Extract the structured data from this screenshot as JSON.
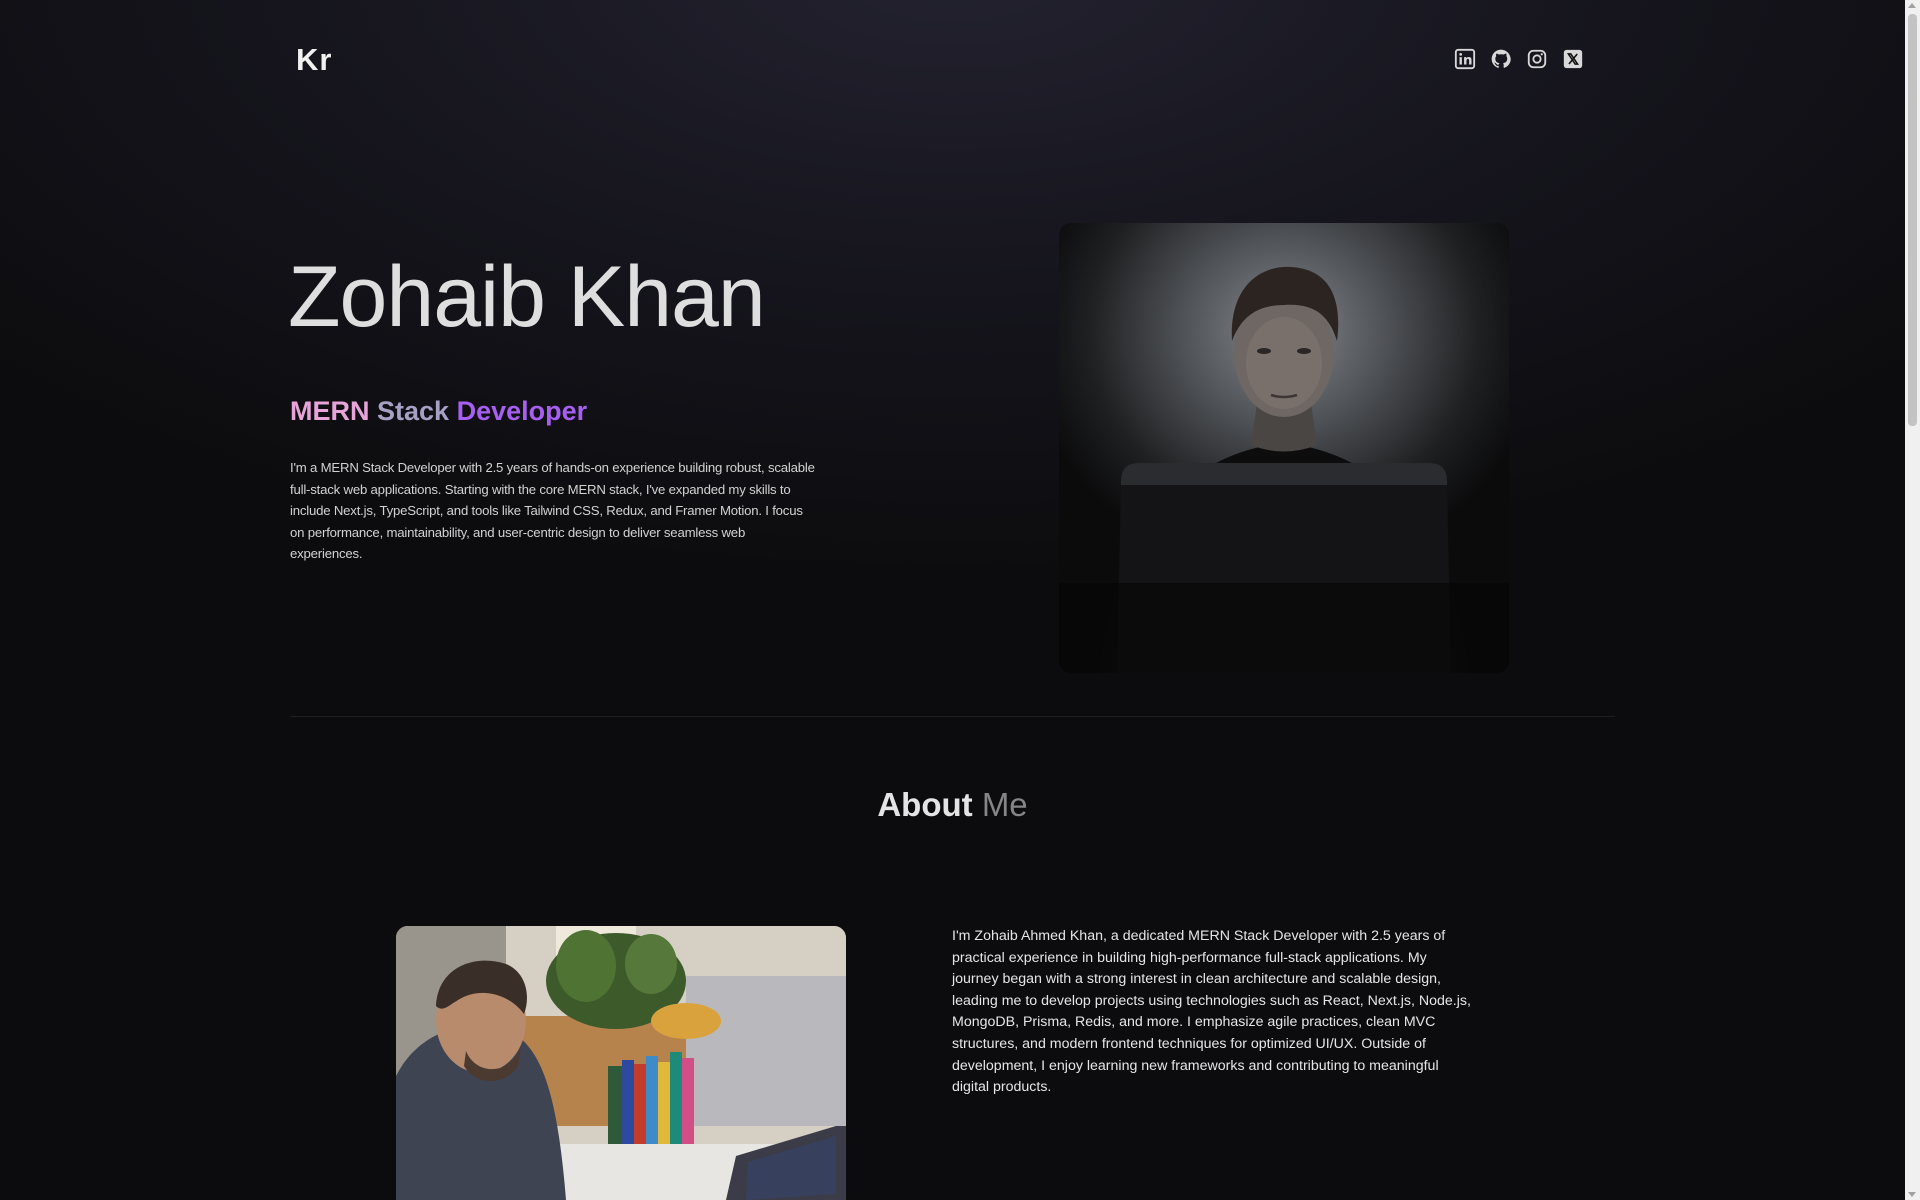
{
  "header": {
    "logo": "Kr",
    "socials": [
      {
        "icon": "linkedin-icon"
      },
      {
        "icon": "github-icon"
      },
      {
        "icon": "instagram-icon"
      },
      {
        "icon": "x-twitter-icon"
      }
    ]
  },
  "hero": {
    "name": "Zohaib Khan",
    "role": [
      "MERN",
      "Stack",
      "Developer"
    ],
    "bio": "I'm a MERN Stack Developer with 2.5 years of hands-on experience building robust, scalable full-stack web applications. Starting with the core MERN stack, I've expanded my skills to include Next.js, TypeScript, and tools like Tailwind CSS, Redux, and Framer Motion. I focus on performance, maintainability, and user-centric design to deliver seamless web experiences.",
    "portrait": "developer-portrait-photo"
  },
  "about": {
    "title_1": "About",
    "title_2": "Me",
    "photo": "developer-at-desk-photo",
    "text": "I'm Zohaib Ahmed Khan, a dedicated MERN Stack Developer with 2.5 years of practical experience in building high-performance full-stack applications. My journey began with a strong interest in clean architecture and scalable design, leading me to develop projects using technologies such as React, Next.js, Node.js, MongoDB, Prisma, Redis, and more. I emphasize agile practices, clean MVC structures, and modern frontend techniques for optimized UI/UX. Outside of development, I enjoy learning new frameworks and contributing to meaningful digital products."
  },
  "colors": {
    "role_pink": "#e6a4d8",
    "role_gray": "#a5a0c4",
    "role_purple": "#a65ff0",
    "page_bg": "#0c0c0e"
  }
}
